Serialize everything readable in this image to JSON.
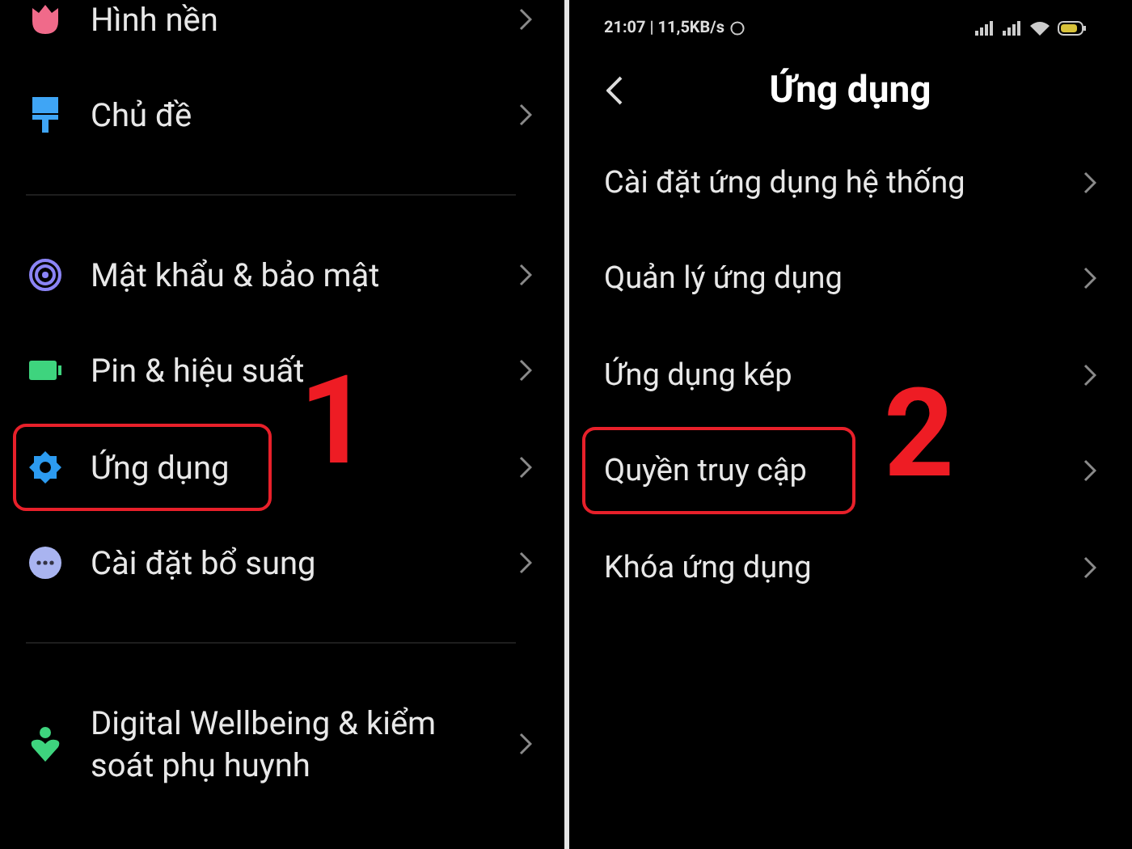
{
  "panels": [
    {
      "kind": "settings",
      "step": "1",
      "groups": [
        [
          {
            "label": "Hình nền",
            "highlighted": false
          },
          {
            "label": "Chủ đề",
            "highlighted": false
          }
        ],
        [
          {
            "label": "Mật khẩu & bảo mật",
            "highlighted": false
          },
          {
            "label": "Pin & hiệu suất",
            "highlighted": false
          },
          {
            "label": "Ứng dụng",
            "highlighted": true
          },
          {
            "label": "Cài đặt bổ sung",
            "highlighted": false
          }
        ],
        [
          {
            "label": "Digital Wellbeing & kiểm soát phụ huynh",
            "highlighted": false
          }
        ]
      ]
    },
    {
      "kind": "apps",
      "step": "2",
      "status_bar": {
        "time": "21:07 | 11,5KB/s"
      },
      "title": "Ứng dụng",
      "groups": [
        [
          {
            "label": "Cài đặt ứng dụng hệ thống",
            "highlighted": false
          },
          {
            "label": "Quản lý ứng dụng",
            "highlighted": false
          },
          {
            "label": "Ứng dụng kép",
            "highlighted": false
          },
          {
            "label": "Quyền truy cập",
            "highlighted": true
          },
          {
            "label": "Khóa ứng dụng",
            "highlighted": false
          }
        ]
      ]
    }
  ]
}
